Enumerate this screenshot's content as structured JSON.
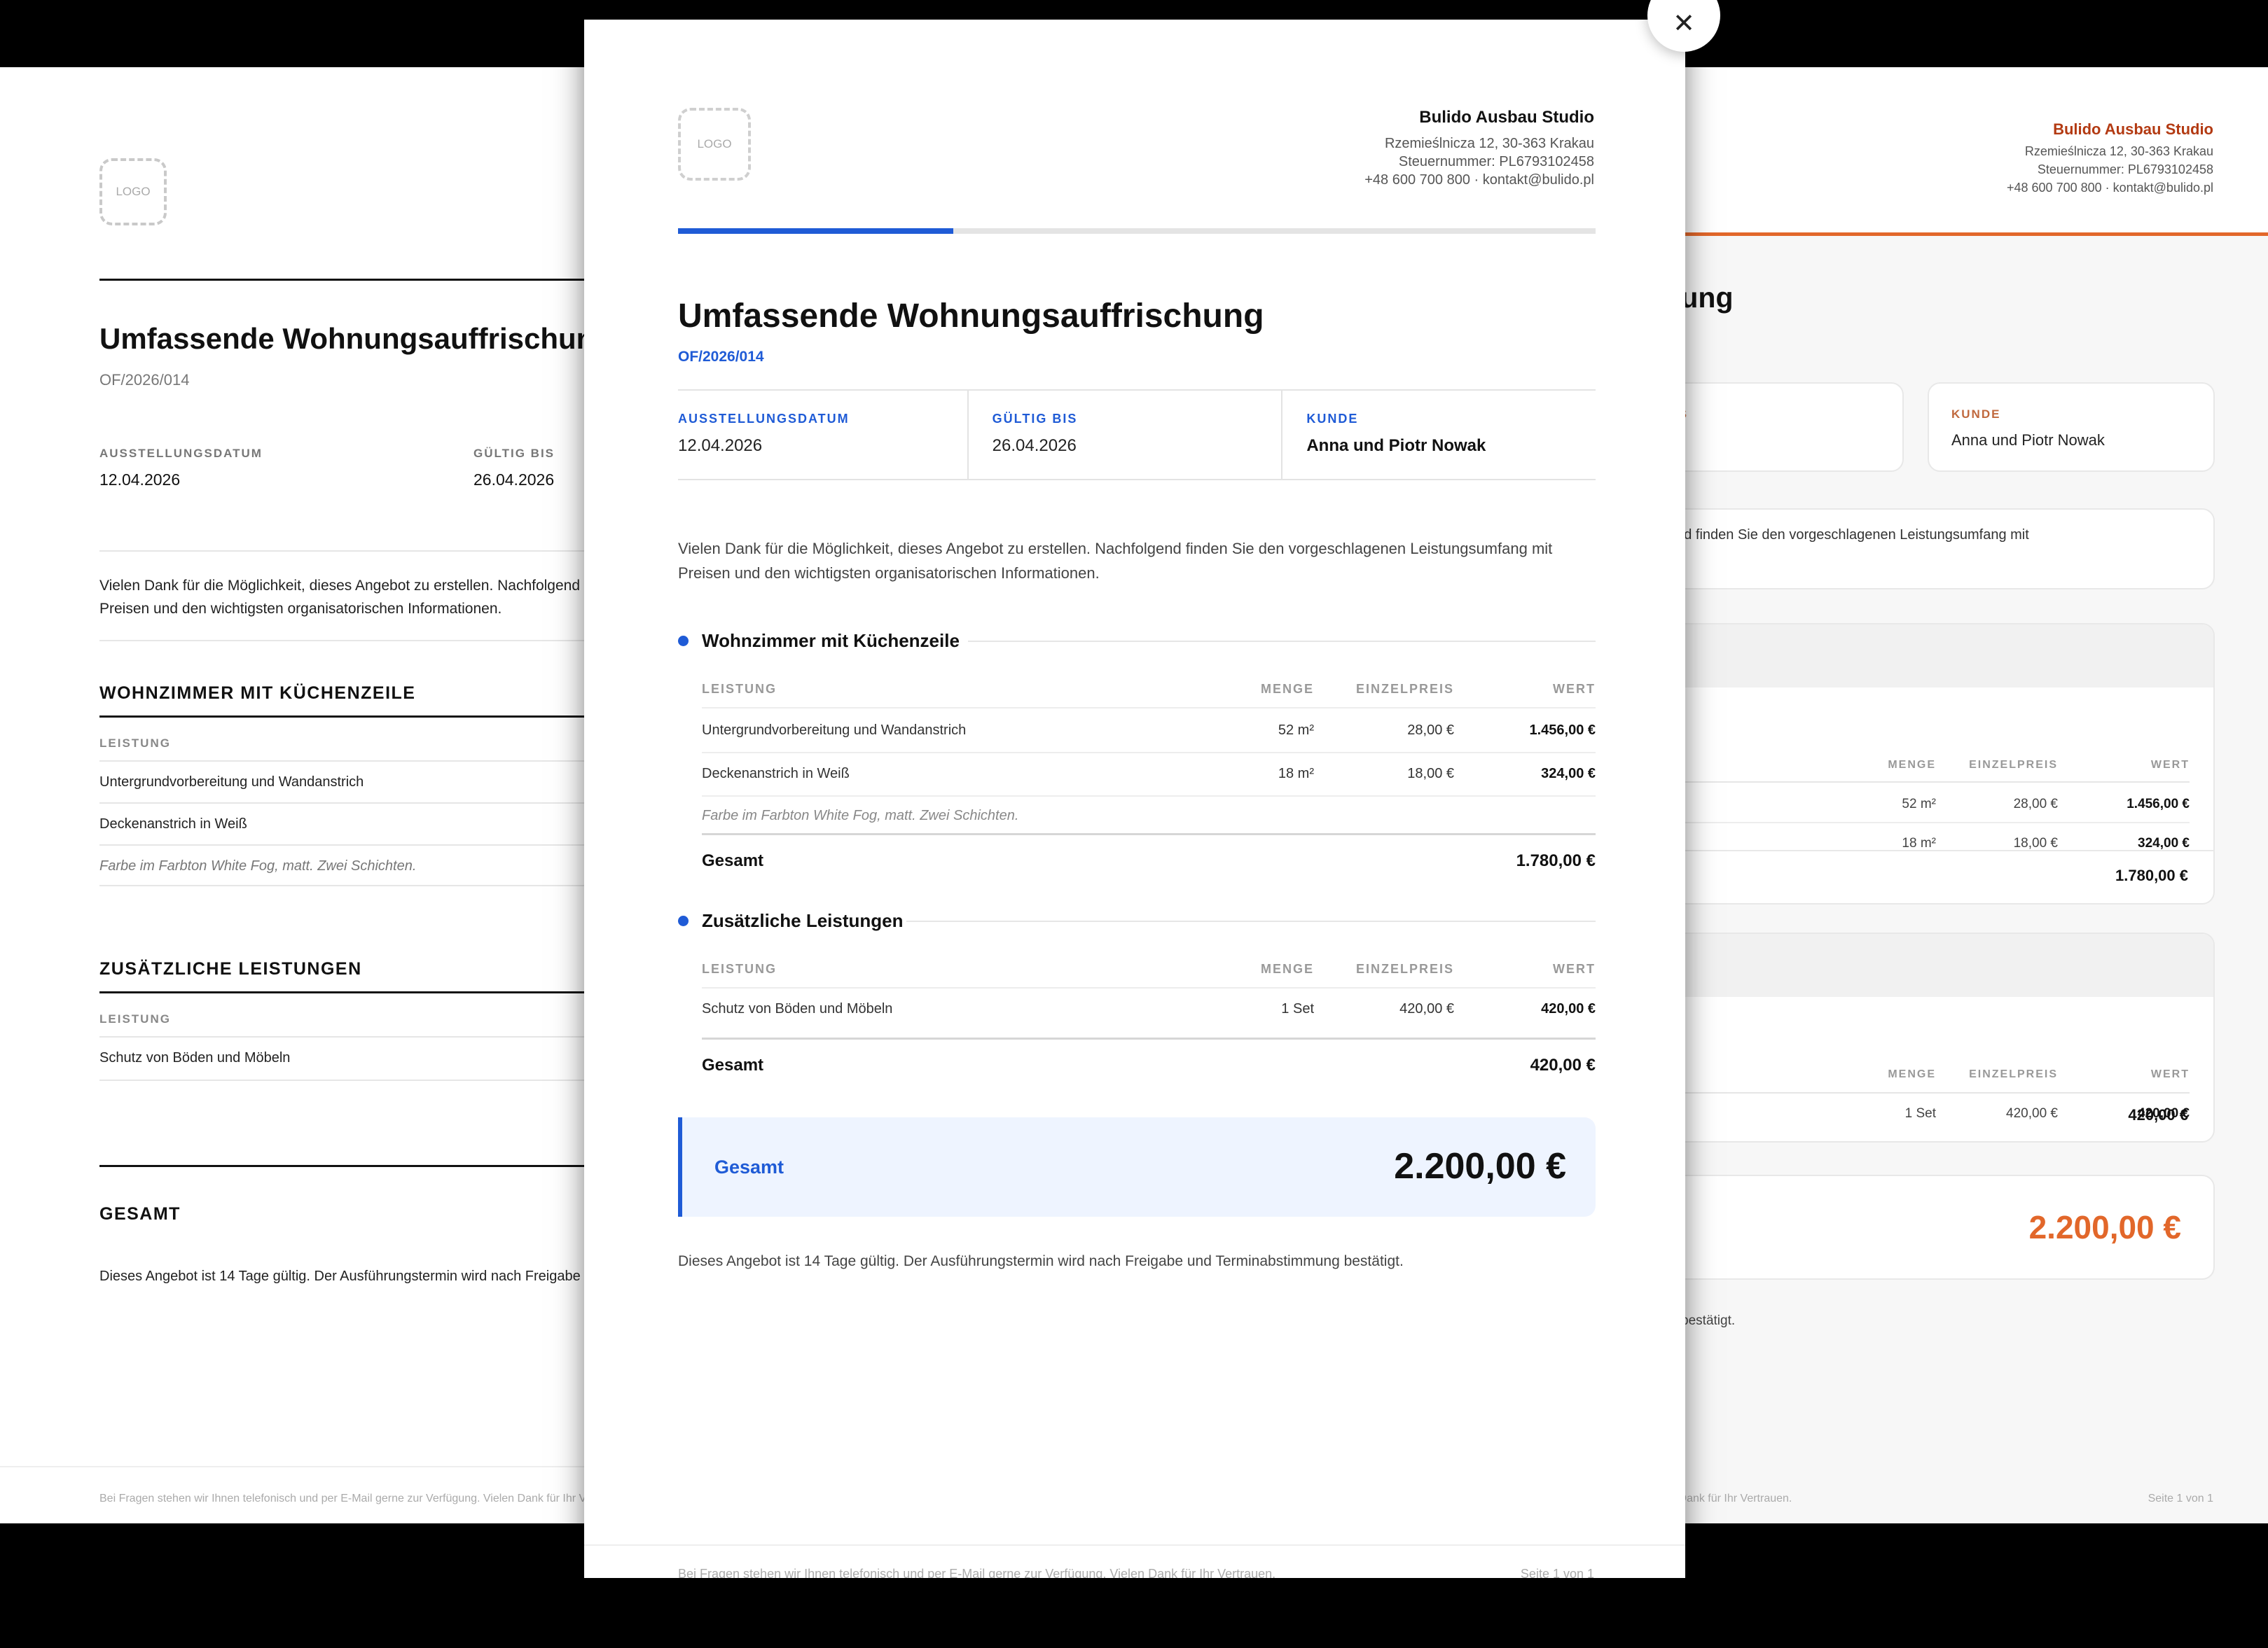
{
  "company": {
    "name": "Bulido Ausbau Studio",
    "address": "Rzemieślnicza 12, 30-363 Krakau",
    "tax_id": "Steuernummer: PL6793102458",
    "contact": "+48 600 700 800 · kontakt@bulido.pl",
    "logo_label": "LOGO"
  },
  "offer": {
    "title": "Umfassende Wohnungsauffrischung",
    "number": "OF/2026/014",
    "issue_label": "AUSSTELLUNGSDATUM",
    "issue_date": "12.04.2026",
    "valid_label": "GÜLTIG BIS",
    "valid_date": "26.04.2026",
    "client_label": "KUNDE",
    "client": "Anna und Piotr Nowak",
    "intro_line1": "Vielen Dank für die Möglichkeit, dieses Angebot zu erstellen. Nachfolgend finden Sie den vorgeschlagenen Leistungsumfang mit",
    "intro_line2": "Preisen und den wichtigsten organisatorischen Informationen."
  },
  "columns": {
    "service": "LEISTUNG",
    "qty": "MENGE",
    "unit_price": "EINZELPREIS",
    "value": "WERT"
  },
  "sections": [
    {
      "title": "Wohnzimmer mit Küchenzeile",
      "title_caps": "WOHNZIMMER MIT KÜCHENZEILE",
      "rows": [
        {
          "service": "Untergrundvorbereitung und Wandanstrich",
          "qty": "52 m²",
          "unit_price": "28,00 €",
          "value": "1.456,00 €"
        },
        {
          "service": "Deckenanstrich in Weiß",
          "qty": "18 m²",
          "unit_price": "18,00 €",
          "value": "324,00 €"
        }
      ],
      "note": "Farbe im Farbton White Fog, matt. Zwei Schichten.",
      "total_label": "Gesamt",
      "total": "1.780,00 €"
    },
    {
      "title": "Zusätzliche Leistungen",
      "title_caps": "ZUSÄTZLICHE LEISTUNGEN",
      "rows": [
        {
          "service": "Schutz von Böden und Möbeln",
          "qty": "1 Set",
          "unit_price": "420,00 €",
          "value": "420,00 €"
        }
      ],
      "total_label": "Gesamt",
      "total": "420,00 €"
    }
  ],
  "grand_total": {
    "label": "Gesamt",
    "label_caps": "GESAMT",
    "value": "2.200,00 €"
  },
  "validity": "Dieses Angebot ist 14 Tage gültig. Der Ausführungstermin wird nach Freigabe und Terminabstimmung bestätigt.",
  "footer": {
    "text": "Bei Fragen stehen wir Ihnen telefonisch und per E-Mail gerne zur Verfügung. Vielen Dank für Ihr Vertrauen.",
    "page": "Seite 1 von 1"
  },
  "progress": 0.3,
  "colors": {
    "modal_accent": "#1f5bd6",
    "right_accent": "#e2672a"
  },
  "icons": {
    "close": "close-icon"
  }
}
